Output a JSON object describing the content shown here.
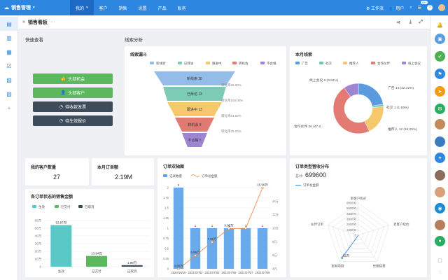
{
  "app": {
    "title": "销售管理"
  },
  "nav": [
    "我的",
    "客户",
    "销售",
    "设置",
    "产品",
    "账务"
  ],
  "topright": {
    "workflow": "工作流",
    "users": "用户",
    "badge": "99+"
  },
  "breadcrumb": {
    "title": "销售看板",
    "menu": "···"
  },
  "sections": {
    "quick": "快速查看",
    "analysis": "线索分析"
  },
  "quick_buttons": [
    "头部机会",
    "头部客户",
    "待收款发票",
    "待生效报价"
  ],
  "colors": {
    "accent": "#2d86e0",
    "green": "#5cb85c",
    "dark": "#3e4b5b"
  },
  "funnel": {
    "title": "线索漏斗",
    "legend": [
      "新线索",
      "已拜访",
      "跟进中",
      "转机会",
      "不合格"
    ],
    "stages": [
      {
        "label": "新线索 20",
        "color": "#93bde8"
      },
      {
        "label": "已拜访 13",
        "color": "#7ccbb3"
      },
      {
        "label": "跟进中 13",
        "color": "#f5c96b"
      },
      {
        "label": "转机会 8",
        "color": "#e27a74"
      },
      {
        "label": "不合格 5",
        "color": "#9f84d1"
      }
    ],
    "rates": [
      "转化率65.00%",
      "转化率100.00%",
      "转化率61.00%",
      "转化率25.00%"
    ]
  },
  "month_leads": {
    "title": "本月线索",
    "legend": [
      "广告",
      "社交",
      "推荐人",
      "合作伙伴",
      "线上会议"
    ],
    "chart_data": {
      "type": "pie",
      "categories": [
        "广告",
        "社交",
        "推荐人",
        "合作伙伴",
        "线上会议"
      ],
      "values": [
        14,
        1,
        12,
        30,
        6
      ],
      "labels": [
        "广告 14 (22.22%)",
        "社交 1 (1.59%)",
        "推荐人 12 (19.05%)",
        "合作伙伴 30 (47.6...",
        "线上会议 6 (9.52%)"
      ],
      "colors": [
        "#5a9be0",
        "#76c7b0",
        "#f5c96b",
        "#e47a74",
        "#9f84d1"
      ]
    }
  },
  "kpi": [
    {
      "title": "我的客户数量",
      "value": "27"
    },
    {
      "title": "本月订单额",
      "value": "2.19M"
    }
  ],
  "status_sales": {
    "title": "各订单状态的销售金额",
    "legend": [
      "生效",
      "已交付",
      "已取消"
    ],
    "chart_data": {
      "type": "bar",
      "categories": [
        "生效",
        "已交付",
        "已取消"
      ],
      "values": [
        53.97,
        13.94,
        1.99
      ],
      "labels": [
        "53.97万",
        "13.94万",
        "1.99万"
      ],
      "yticks": [
        "0",
        "10万",
        "20万",
        "30万",
        "40万",
        "50万",
        "60万"
      ],
      "ylim": [
        0,
        60
      ],
      "colors": [
        "#5bc8c8",
        "#5cb85c",
        "#3e4b5b"
      ]
    }
  },
  "dual_axis": {
    "title": "订单双轴图",
    "legend": [
      "记录数量",
      "订单总金额"
    ],
    "chart_data": {
      "type": "bar",
      "categories": [
        "2020/10/15",
        "2021/07/02",
        "2021/07/03",
        "2021/07/05",
        "2021/07/27",
        "2021/07/29"
      ],
      "series": [
        {
          "name": "记录数量",
          "values": [
            2,
            1,
            1,
            1,
            1,
            1
          ]
        },
        {
          "name": "订单总金额",
          "values": [
            3.96,
            5.96,
            7.95,
            9.95,
            9.97,
            15.96
          ]
        }
      ],
      "bar_labels": [
        "2",
        "1",
        "1",
        "1",
        "1",
        "1"
      ],
      "line_labels": [
        "3.96万",
        "5.96万",
        "7.95万",
        "9.95万",
        "",
        "15.96万"
      ],
      "yticks_left": [
        "0",
        "0.25",
        "0.5",
        "0.75",
        "1",
        "1.25",
        "1.5",
        "1.75",
        "2"
      ],
      "yticks_right": [
        "4万",
        "6万",
        "8万",
        "10万",
        "12万",
        "14万"
      ],
      "ylim_left": [
        0,
        2
      ],
      "ylim_right": [
        4,
        16
      ]
    }
  },
  "radar": {
    "title": "订单类型营收分布",
    "total_label": "总计:",
    "total": "699600",
    "legend": "订单总金额",
    "chart_data": {
      "type": "radar",
      "categories": [
        "新客户购买",
        "老客户续约",
        "长期续费",
        "定制项目",
        "伙伴订单"
      ],
      "values": [
        0,
        0,
        0,
        520000,
        0
      ],
      "ticks": [
        "0",
        "100000",
        "200000",
        "300000",
        "400000",
        "500000",
        "600000"
      ],
      "point_label": "52万"
    }
  }
}
